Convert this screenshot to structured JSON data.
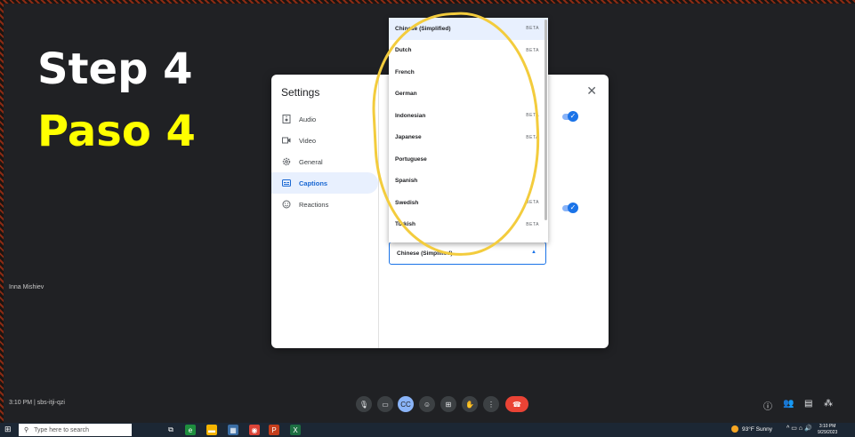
{
  "overlay": {
    "step_en": "Step 4",
    "step_es": "Paso 4"
  },
  "participant_name": "Inna Mishiev",
  "settings": {
    "title": "Settings",
    "close_label": "✕",
    "nav": [
      {
        "label": "Audio",
        "icon": "speaker-icon"
      },
      {
        "label": "Video",
        "icon": "camera-icon"
      },
      {
        "label": "General",
        "icon": "gear-icon"
      },
      {
        "label": "Captions",
        "icon": "captions-icon",
        "active": true
      },
      {
        "label": "Reactions",
        "icon": "smiley-icon"
      }
    ],
    "selected_language": "Chinese (Simplified)"
  },
  "dropdown": {
    "items": [
      {
        "label": "Chinese (Simplified)",
        "badge": "BETA",
        "selected": true
      },
      {
        "label": "Dutch",
        "badge": "BETA"
      },
      {
        "label": "French",
        "badge": ""
      },
      {
        "label": "German",
        "badge": ""
      },
      {
        "label": "Indonesian",
        "badge": "BETA"
      },
      {
        "label": "Japanese",
        "badge": "BETA"
      },
      {
        "label": "Portuguese",
        "badge": ""
      },
      {
        "label": "Spanish",
        "badge": ""
      },
      {
        "label": "Swedish",
        "badge": "BETA"
      },
      {
        "label": "Turkish",
        "badge": "BETA"
      }
    ]
  },
  "meeting": {
    "info": "3:10 PM  |  sbs-itji-qzi"
  },
  "taskbar": {
    "search_placeholder": "Type here to search",
    "weather": "93°F  Sunny",
    "time": "3:10 PM",
    "date": "9/29/2023"
  },
  "colors": {
    "accent": "#1a73e8",
    "highlight": "#f3cc3d",
    "step_es": "#ffff00"
  }
}
